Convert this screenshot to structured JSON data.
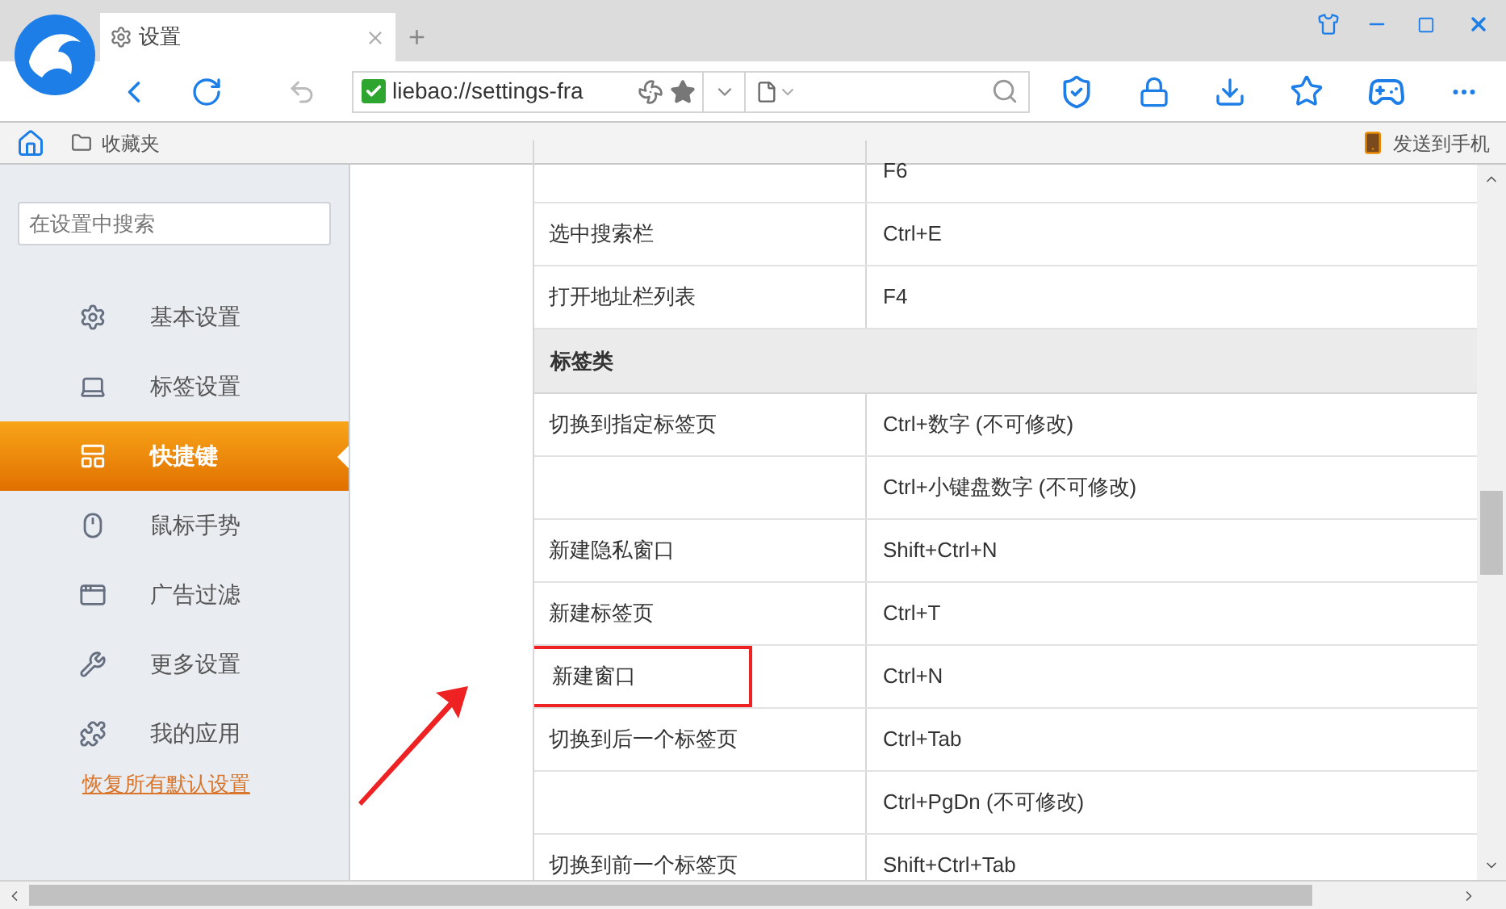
{
  "tabs": [
    {
      "title": "设置",
      "selected": true
    }
  ],
  "new_tab": "+",
  "address_bar": {
    "url": "liebao://settings-fra"
  },
  "bookmarks_bar": {
    "folder": "收藏夹",
    "send_to_phone": "发送到手机"
  },
  "sidebar": {
    "search": {
      "placeholder": "在设置中搜索"
    },
    "items": [
      {
        "label": "基本设置",
        "selected": false
      },
      {
        "label": "标签设置",
        "selected": false
      },
      {
        "label": "快捷键",
        "selected": true
      },
      {
        "label": "鼠标手势",
        "selected": false
      },
      {
        "label": "广告过滤",
        "selected": false
      },
      {
        "label": "更多设置",
        "selected": false
      },
      {
        "label": "我的应用",
        "selected": false
      }
    ],
    "reset_link": "恢复所有默认设置"
  },
  "table": {
    "rows": [
      {
        "kind": "shortcut",
        "action": "",
        "keys": "F6",
        "highlighted": false
      },
      {
        "kind": "shortcut",
        "action": "选中搜索栏",
        "keys": "Ctrl+E",
        "highlighted": false
      },
      {
        "kind": "shortcut",
        "action": "打开地址栏列表",
        "keys": "F4",
        "highlighted": false
      },
      {
        "kind": "section",
        "action": "标签类"
      },
      {
        "kind": "shortcut",
        "action": "切换到指定标签页",
        "keys": "Ctrl+数字 (不可修改)",
        "highlighted": false
      },
      {
        "kind": "shortcut",
        "action": "",
        "keys": "Ctrl+小键盘数字 (不可修改)",
        "highlighted": false
      },
      {
        "kind": "shortcut",
        "action": "新建隐私窗口",
        "keys": "Shift+Ctrl+N",
        "highlighted": false
      },
      {
        "kind": "shortcut",
        "action": "新建标签页",
        "keys": "Ctrl+T",
        "highlighted": false
      },
      {
        "kind": "shortcut",
        "action": "新建窗口",
        "keys": "Ctrl+N",
        "highlighted": true
      },
      {
        "kind": "shortcut",
        "action": "切换到后一个标签页",
        "keys": "Ctrl+Tab",
        "highlighted": false
      },
      {
        "kind": "shortcut",
        "action": "",
        "keys": "Ctrl+PgDn (不可修改)",
        "highlighted": false
      },
      {
        "kind": "shortcut",
        "action": "切换到前一个标签页",
        "keys": "Shift+Ctrl+Tab",
        "highlighted": false
      }
    ]
  }
}
